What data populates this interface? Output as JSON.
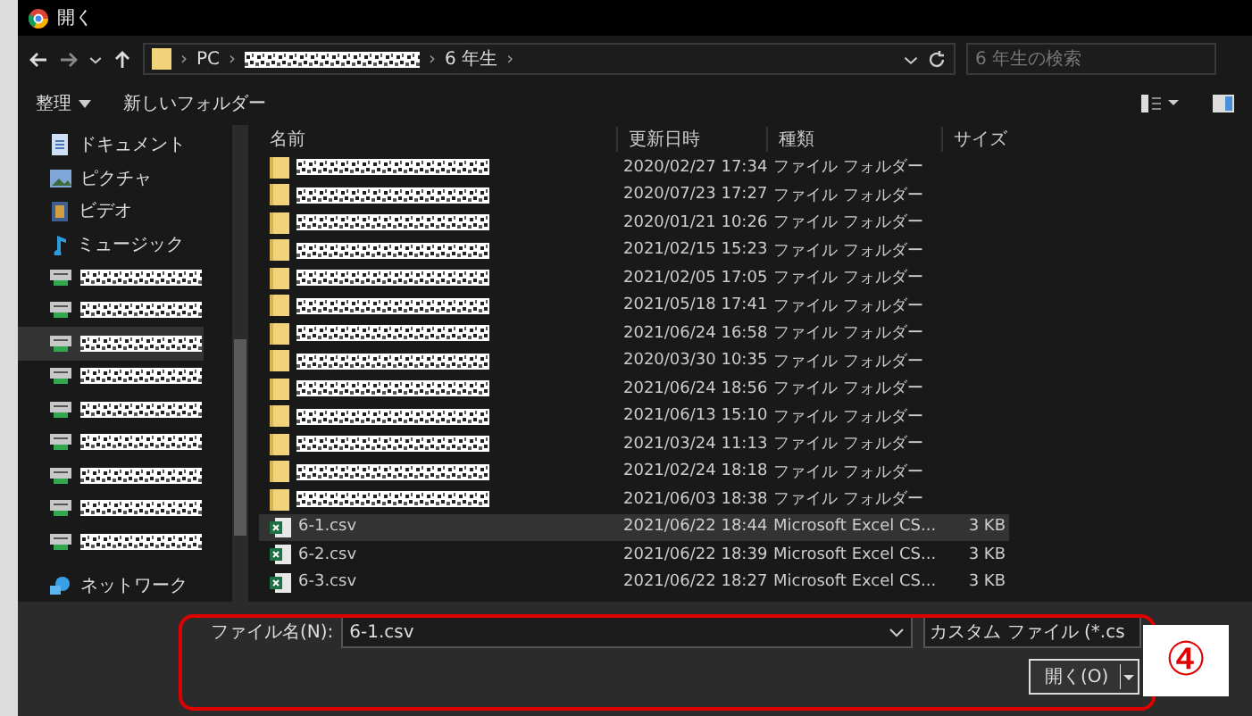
{
  "window": {
    "title": "開く"
  },
  "address": {
    "separator": "›",
    "path": [
      {
        "kind": "folder"
      },
      {
        "kind": "text",
        "text": "PC"
      },
      {
        "kind": "redacted"
      },
      {
        "kind": "text",
        "text": "6 年生"
      }
    ]
  },
  "search": {
    "placeholder": "6 年生の検索"
  },
  "toolbar": {
    "organize": "整理",
    "new_folder": "新しいフォルダー"
  },
  "sidebar": {
    "items": [
      {
        "kind": "documents",
        "label": "ドキュメント",
        "selected": false
      },
      {
        "kind": "pictures",
        "label": "ピクチャ",
        "selected": false
      },
      {
        "kind": "videos",
        "label": "ビデオ",
        "selected": false
      },
      {
        "kind": "music",
        "label": "ミュージック",
        "selected": false
      },
      {
        "kind": "drive",
        "selected": false
      },
      {
        "kind": "drive",
        "selected": false
      },
      {
        "kind": "drive",
        "selected": true
      },
      {
        "kind": "drive",
        "selected": false
      },
      {
        "kind": "drive",
        "selected": false
      },
      {
        "kind": "drive",
        "selected": false
      },
      {
        "kind": "drive",
        "selected": false
      },
      {
        "kind": "drive",
        "selected": false
      },
      {
        "kind": "drive",
        "selected": false
      },
      {
        "kind": "network",
        "label": "ネットワーク",
        "selected": false
      }
    ]
  },
  "file_list": {
    "columns": [
      "名前",
      "更新日時",
      "種類",
      "サイズ"
    ],
    "rows": [
      {
        "kind": "folder",
        "modified": "2020/02/27 17:34",
        "type": "ファイル フォルダー",
        "selected": false
      },
      {
        "kind": "folder",
        "modified": "2020/07/23 17:27",
        "type": "ファイル フォルダー",
        "selected": false
      },
      {
        "kind": "folder",
        "modified": "2020/01/21 10:26",
        "type": "ファイル フォルダー",
        "selected": false
      },
      {
        "kind": "folder",
        "modified": "2021/02/15 15:23",
        "type": "ファイル フォルダー",
        "selected": false
      },
      {
        "kind": "folder",
        "modified": "2021/02/05 17:05",
        "type": "ファイル フォルダー",
        "selected": false
      },
      {
        "kind": "folder",
        "modified": "2021/05/18 17:41",
        "type": "ファイル フォルダー",
        "selected": false
      },
      {
        "kind": "folder",
        "modified": "2021/06/24 16:58",
        "type": "ファイル フォルダー",
        "selected": false
      },
      {
        "kind": "folder",
        "modified": "2020/03/30 10:35",
        "type": "ファイル フォルダー",
        "selected": false
      },
      {
        "kind": "folder",
        "modified": "2021/06/24 18:56",
        "type": "ファイル フォルダー",
        "selected": false
      },
      {
        "kind": "folder",
        "modified": "2021/06/13 15:10",
        "type": "ファイル フォルダー",
        "selected": false
      },
      {
        "kind": "folder",
        "modified": "2021/03/24 11:13",
        "type": "ファイル フォルダー",
        "selected": false
      },
      {
        "kind": "folder",
        "modified": "2021/02/24 18:18",
        "type": "ファイル フォルダー",
        "selected": false
      },
      {
        "kind": "folder",
        "modified": "2021/06/03 18:38",
        "type": "ファイル フォルダー",
        "selected": false
      },
      {
        "kind": "csv",
        "name": "6-1.csv",
        "modified": "2021/06/22 18:44",
        "type": "Microsoft Excel CS...",
        "size": "3 KB",
        "selected": true
      },
      {
        "kind": "csv",
        "name": "6-2.csv",
        "modified": "2021/06/22 18:39",
        "type": "Microsoft Excel CS...",
        "size": "3 KB",
        "selected": false
      },
      {
        "kind": "csv",
        "name": "6-3.csv",
        "modified": "2021/06/22 18:27",
        "type": "Microsoft Excel CS...",
        "size": "3 KB",
        "selected": false
      }
    ]
  },
  "bottom": {
    "filename_label": "ファイル名(N):",
    "filename": "6-1.csv",
    "filetype": "カスタム ファイル (*.cs",
    "open_button": "開く(O)"
  },
  "annotation": {
    "marker": "④"
  }
}
